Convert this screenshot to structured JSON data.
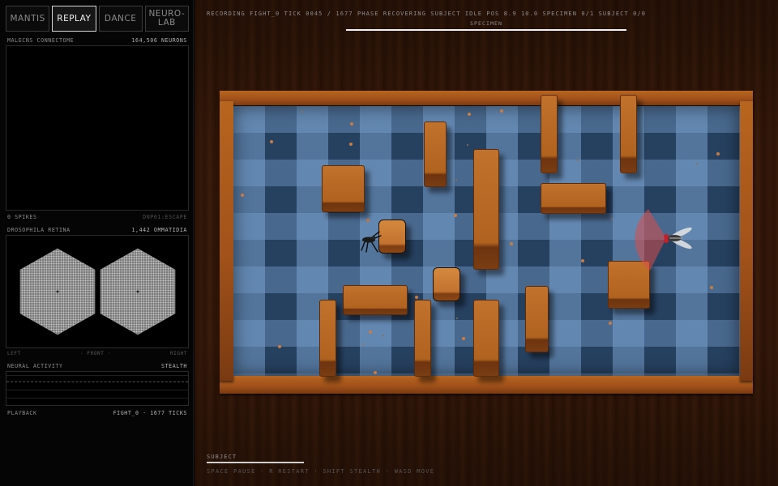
{
  "tabs": [
    {
      "label": "MANTIS",
      "active": false
    },
    {
      "label": "REPLAY",
      "active": true
    },
    {
      "label": "DANCE",
      "active": false
    },
    {
      "label": "NEURO-\nLAB",
      "active": false
    }
  ],
  "connectome": {
    "title": "MALECNS CONNECTOME",
    "count": "164,506 NEURONS",
    "spikes": "0 SPIKES",
    "mode": "DNP01:ESCAPE"
  },
  "retina": {
    "title": "DROSOPHILA RETINA",
    "count": "1,442 OMMATIDIA",
    "left": "LEFT",
    "front": "· FRONT ·",
    "right": "RIGHT"
  },
  "activity": {
    "title": "NEURAL ACTIVITY",
    "state": "STEALTH"
  },
  "playback": {
    "title": "PLAYBACK",
    "info": "FIGHT_0 · 1677 TICKS"
  },
  "status_line": "RECORDING FIGHT_0 TICK 0045 / 1677 PHASE RECOVERING SUBJECT IDLE POS 8.9 10.0 SPECIMEN 0/1 SUBJECT 0/0",
  "specimen": {
    "label": "SPECIMEN",
    "progress": 1.0
  },
  "subject": {
    "label": "SUBJECT",
    "progress": 1.0
  },
  "hint": "SPACE PAUSE · R RESTART · SHIFT STEALTH · WASD MOVE",
  "colors": {
    "wood": "#b0621f",
    "floor_dark": "#26405f",
    "floor_light": "#7aa0cd",
    "vision_cone": "#d94c4c"
  }
}
